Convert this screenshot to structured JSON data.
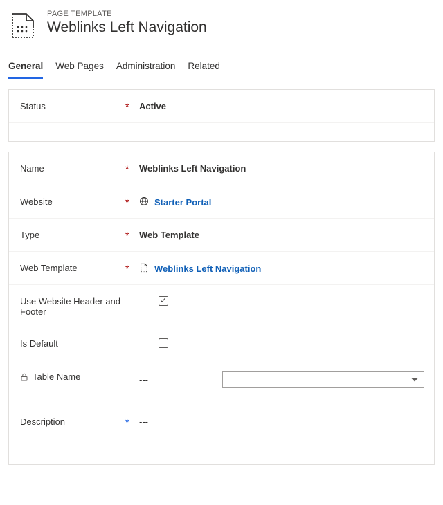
{
  "header": {
    "eyebrow": "PAGE TEMPLATE",
    "title": "Weblinks Left Navigation"
  },
  "tabs": {
    "general": "General",
    "webpages": "Web Pages",
    "administration": "Administration",
    "related": "Related"
  },
  "fields": {
    "status": {
      "label": "Status",
      "value": "Active"
    },
    "name": {
      "label": "Name",
      "value": "Weblinks Left Navigation"
    },
    "website": {
      "label": "Website",
      "value": "Starter Portal"
    },
    "type": {
      "label": "Type",
      "value": "Web Template"
    },
    "webtemplate": {
      "label": "Web Template",
      "value": "Weblinks Left Navigation"
    },
    "usewebsiteheader": {
      "label": "Use Website Header and Footer",
      "checked": true
    },
    "isdefault": {
      "label": "Is Default",
      "checked": false
    },
    "tablename": {
      "label": "Table Name",
      "value": "---"
    },
    "description": {
      "label": "Description",
      "value": "---"
    }
  },
  "icons": {
    "page": "page-template-icon",
    "globe": "globe-icon",
    "document": "document-icon",
    "lock": "lock-icon"
  }
}
